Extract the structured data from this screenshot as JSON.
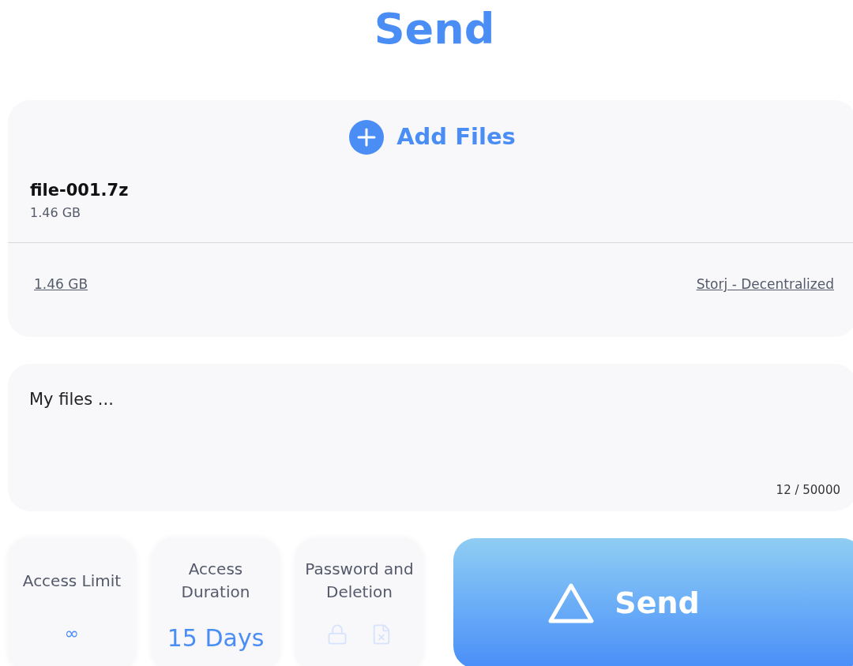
{
  "title": "Send",
  "add_files": {
    "label": "Add Files"
  },
  "files": [
    {
      "name": "file-001.7z",
      "size": "1.46 GB"
    }
  ],
  "summary": {
    "total_size": "1.46 GB",
    "storage": "Storj - Decentralized"
  },
  "message": {
    "value": "My files ...",
    "counter": "12 / 50000"
  },
  "options": [
    {
      "kind": "value",
      "label": "Access Limit",
      "value": "∞"
    },
    {
      "kind": "value",
      "label": "Access Duration",
      "value": "15 Days"
    },
    {
      "kind": "toggles",
      "label": "Password and Deletion",
      "password": false,
      "deletion": false
    }
  ],
  "send_button": {
    "label": "Send"
  }
}
